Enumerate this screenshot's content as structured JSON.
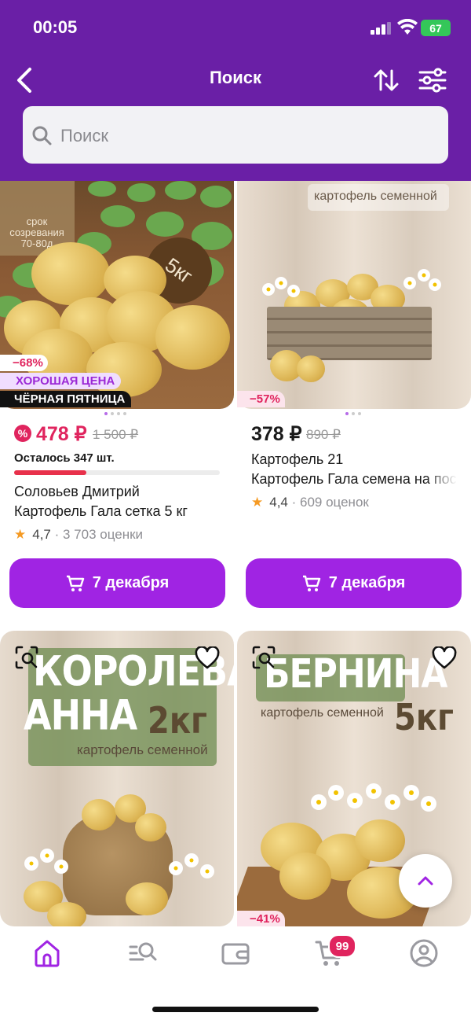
{
  "status_bar": {
    "time": "00:05",
    "battery": "67"
  },
  "header": {
    "title": "Поиск"
  },
  "search": {
    "placeholder": "Поиск"
  },
  "products": [
    {
      "image_texts": [
        "срок созревания 70-80д",
        "5кг"
      ],
      "discount": "−68%",
      "badge_good_price": "ХОРОШАЯ ЦЕНА",
      "badge_black_friday": "ЧЁРНАЯ ПЯТНИЦА",
      "price": "478 ₽",
      "old_price": "1 500 ₽",
      "stock": "Осталось 347 шт.",
      "stock_progress": 0.35,
      "seller": "Соловьев Дмитрий",
      "title": "Картофель Гала сетка 5 кг",
      "rating": "4,7",
      "reviews": "· 3 703 оценки",
      "button": "7 декабря"
    },
    {
      "image_texts": [
        "картофель семенной"
      ],
      "discount": "−57%",
      "price": "378 ₽",
      "old_price": "890 ₽",
      "seller": "Картофель 21",
      "title": "Картофель Гала семена на пос",
      "rating": "4,4",
      "reviews": "· 609 оценок",
      "button": "7 декабря"
    },
    {
      "image_texts": [
        "КОРОЛЕВА",
        "АННА",
        "2кг",
        "картофель семенной"
      ]
    },
    {
      "image_texts": [
        "БЕРНИНА",
        "картофель семенной",
        "5кг"
      ],
      "discount": "−41%"
    }
  ],
  "tabbar": {
    "cart_count": "99"
  },
  "colors": {
    "header": "#6a1fa6",
    "accent": "#a024e3",
    "sale": "#e0245e"
  },
  "icons": [
    "back-arrow-icon",
    "sort-icon",
    "filter-icon",
    "search-icon",
    "cart-icon",
    "heart-icon",
    "visual-search-icon",
    "chevron-up-icon",
    "home-icon",
    "catalog-icon",
    "wallet-icon",
    "profile-icon"
  ]
}
